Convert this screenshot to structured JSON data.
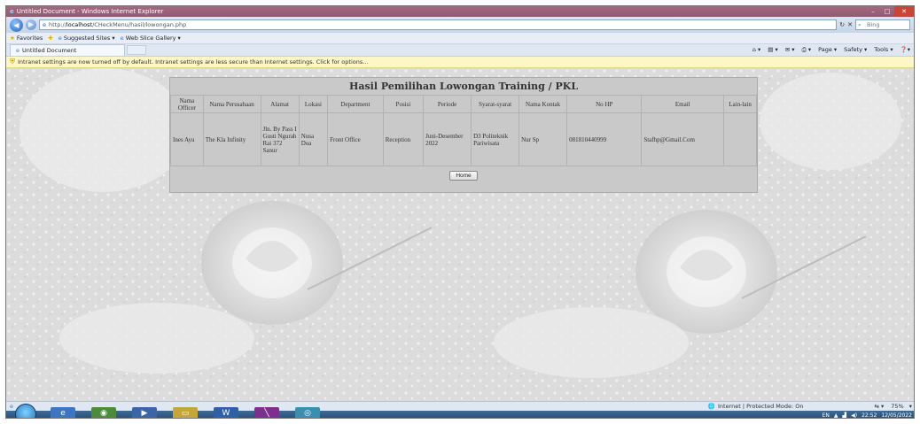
{
  "window": {
    "title": "Untitled Document - Windows Internet Explorer",
    "buttons": [
      "–",
      "□",
      "✕"
    ]
  },
  "addressbar": {
    "url_prefix": "http://",
    "url_host": "localhost",
    "url_path": "/CHeckMenu/hasil/lowongan.php",
    "search_placeholder": "Bing",
    "refresh_glyph": "↻",
    "stop_glyph": "✕"
  },
  "favorites": {
    "label": "Favorites",
    "items": [
      "Suggested Sites ▾",
      "Web Slice Gallery ▾"
    ]
  },
  "tab": {
    "label": "Untitled Document"
  },
  "commandbar": {
    "items": [
      "Page ▾",
      "Safety ▾",
      "Tools ▾"
    ]
  },
  "infobar": {
    "message": "Intranet settings are now turned off by default. Intranet settings are less secure than Internet settings. Click for options..."
  },
  "result": {
    "title": "Hasil Pemilihan Lowongan Training / PKL",
    "columns": [
      "Nama Officer",
      "Nama Perusahaan",
      "Alamat",
      "Lokasi",
      "Department",
      "Posisi",
      "Periode",
      "Syarat-syarat",
      "Nama Kontak",
      "No HP",
      "Email",
      "Lain-lain"
    ],
    "rows": [
      [
        "Ines Ayu",
        "The Kla Infinity",
        "Jln. By Pass I Gusti Ngurah Rai 372 Sanur",
        "Nusa Dua",
        "Front Office",
        "Reception",
        "Juni-Desember 2022",
        "D3 Politeknik Pariwisata",
        "Nur Sp",
        "081810440999",
        "Stafhp@Gmail.Com",
        ""
      ]
    ],
    "home_button": "Home"
  },
  "statusbar": {
    "zone": "Internet | Protected Mode: On",
    "zoom": "75%"
  },
  "taskbar": {
    "tray_lang": "EN",
    "time": "22:52",
    "date": "12/05/2022"
  }
}
